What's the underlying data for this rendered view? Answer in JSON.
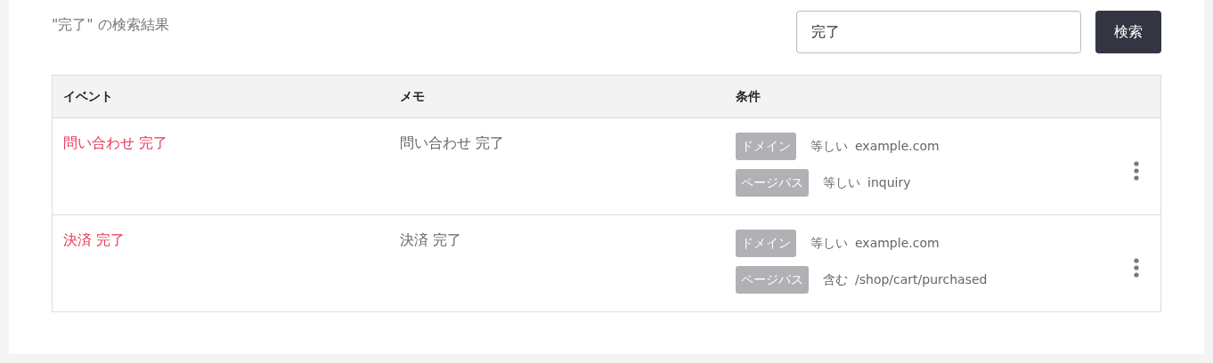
{
  "heading": "\"完了\" の検索結果",
  "search": {
    "value": "完了",
    "button": "検索"
  },
  "table": {
    "columns": [
      "イベント",
      "メモ",
      "条件"
    ],
    "rows": [
      {
        "event": "問い合わせ 完了",
        "memo": "問い合わせ 完了",
        "conditions": [
          {
            "tag": "ドメイン",
            "operator": "等しい",
            "value": "example.com"
          },
          {
            "tag": "ページパス",
            "operator": "等しい",
            "value": "inquiry"
          }
        ]
      },
      {
        "event": "決済 完了",
        "memo": "決済 完了",
        "conditions": [
          {
            "tag": "ドメイン",
            "operator": "等しい",
            "value": "example.com"
          },
          {
            "tag": "ページパス",
            "operator": "含む",
            "value": "/shop/cart/purchased"
          }
        ]
      }
    ]
  }
}
